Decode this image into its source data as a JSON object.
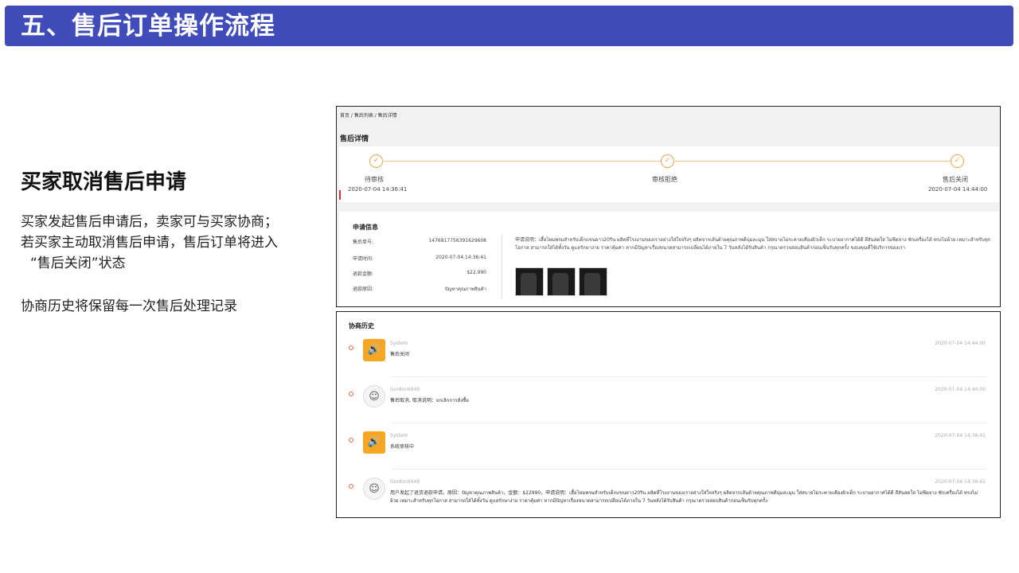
{
  "slide": {
    "title": "五、售后订单操作流程",
    "section_title": "买家取消售后申请",
    "lines": [
      "买家发起售后申请后，卖家可与买家协商；",
      "若买家主动取消售后申请，售后订单将进入",
      "“售后关闭”状态",
      "协商历史将保留每一次售后处理记录"
    ]
  },
  "detail": {
    "breadcrumb": "首页  /  售后列表  /  售后详情",
    "title": "售后详情",
    "steps": [
      {
        "label": "待审核",
        "time": "2020-07-04 14:36:41",
        "icon": "check-icon"
      },
      {
        "label": "审核拒绝",
        "time": "",
        "icon": "check-icon"
      },
      {
        "label": "售后关闭",
        "time": "2020-07-04 14:44:00",
        "icon": "check-icon"
      }
    ],
    "info": {
      "title": "申请信息",
      "fields": [
        {
          "key": "售后单号:",
          "value": "1476817756391629608"
        },
        {
          "key": "申请时间:",
          "value": "2020-07-04 14:36:41"
        },
        {
          "key": "退款金额:",
          "value": "$22,990"
        },
        {
          "key": "退款原因:",
          "value": "ปัญหาคุณภาพสินค้า"
        }
      ],
      "description": "申请说明：เสื้อไหมพรมสำหรับเด็กแขนยาว20ริน ผลิตที่โรงงานของเราอย่างใส่ใจจริงๆ ผลิตจากเส้นด้ายคุณภาพดีนุ่มละมุน ใส่สบายไม่ระคายเคืองผิวเด็ก ระบายอากาศได้ดี สีสันสดใส ไม่ซีดจาง ซักเครื่องได้ ทรงไม่ย้วย เหมาะสำหรับทุกโอกาส สามารถใส่ได้ทั้งวัน ดูแลรักษาง่าย ราคาคุ้มค่า หากมีปัญหาเรื่องขนาดสามารถเปลี่ยนได้ภายใน 7 วันหลังได้รับสินค้า กรุณาตรวจสอบสินค้าก่อนเซ็นรับทุกครั้ง ขอบคุณที่ใช้บริการของเรา"
    }
  },
  "history": {
    "title": "协商历史",
    "items": [
      {
        "avatar": "system",
        "icon": "speaker-icon",
        "user": "System",
        "time": "2020-07-04 14:44:00",
        "text": "售后关闭"
      },
      {
        "avatar": "user",
        "icon": "avatar-icon",
        "user": "Gordon6949",
        "time": "2020-07-04 14:44:00",
        "text": "售后取消, 取消说明：ยกเลิกการสั่งซื้อ"
      },
      {
        "avatar": "system",
        "icon": "speaker-icon",
        "user": "System",
        "time": "2020-07-04 14:36:41",
        "text": "系统审核中"
      },
      {
        "avatar": "user",
        "icon": "avatar-icon",
        "user": "Gordon6949",
        "time": "2020-07-04 14:36:41",
        "text": "用户发起了退货退款申请。原因：ปัญหาคุณภาพสินค้า，金额：$22990，申请说明：เสื้อไหมพรมสำหรับเด็กแขนยาว20ริน ผลิตที่โรงงานของเราอย่างใส่ใจจริงๆ ผลิตจากเส้นด้ายคุณภาพดีนุ่มละมุน ใส่สบายไม่ระคายเคืองผิวเด็ก ระบายอากาศได้ดี สีสันสดใส ไม่ซีดจาง ซักเครื่องได้ ทรงไม่ย้วย เหมาะสำหรับทุกโอกาส สามารถใส่ได้ทั้งวัน ดูแลรักษาง่าย ราคาคุ้มค่า หากมีปัญหาเรื่องขนาดสามารถเปลี่ยนได้ภายใน 7 วันหลังได้รับสินค้า กรุณาตรวจสอบสินค้าก่อนเซ็นรับทุกครั้ง"
      }
    ]
  },
  "colors": {
    "header_bg": "#3f4cb9",
    "step_accent": "#e8a44d",
    "system_avatar": "#f5a623"
  }
}
